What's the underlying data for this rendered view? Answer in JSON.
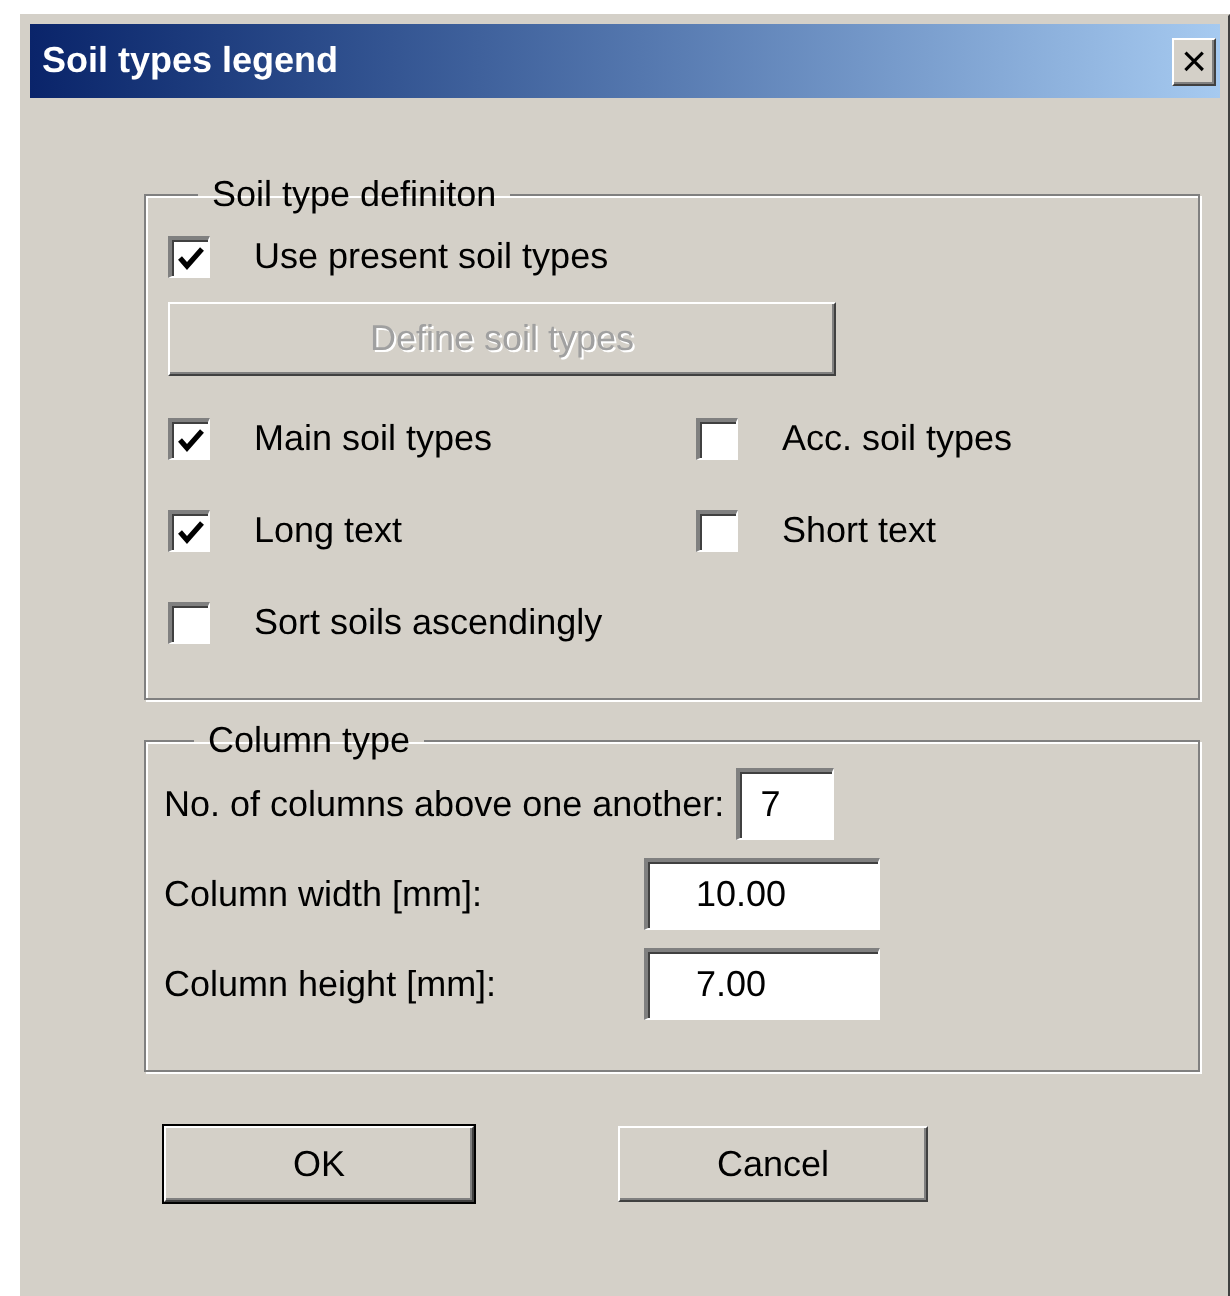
{
  "window": {
    "title": "Soil types legend",
    "close": "×"
  },
  "definition_group": {
    "title": "Soil type definiton",
    "use_present": {
      "label": "Use present soil types",
      "checked": true
    },
    "define_button": {
      "label": "Define soil types",
      "disabled": true
    },
    "option_rows": [
      [
        {
          "label": "Main soil types",
          "checked": true
        },
        {
          "label": "Acc. soil types",
          "checked": false
        }
      ],
      [
        {
          "label": "Long text",
          "checked": true
        },
        {
          "label": "Short text",
          "checked": false
        }
      ],
      [
        {
          "label": "Sort soils ascendingly",
          "checked": false
        }
      ]
    ]
  },
  "column_group": {
    "title": "Column type",
    "fields": [
      {
        "label": "No. of columns above one another:",
        "value": "7",
        "kind": "small"
      },
      {
        "label": "Column width [mm]:",
        "value": "10.00",
        "kind": "wide"
      },
      {
        "label": "Column height [mm]:",
        "value": "7.00",
        "kind": "wide"
      }
    ]
  },
  "buttons": [
    {
      "label": "OK",
      "default": true
    },
    {
      "label": "Cancel",
      "default": false
    }
  ]
}
